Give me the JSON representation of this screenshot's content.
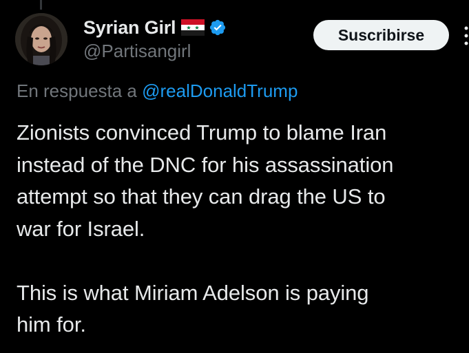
{
  "user": {
    "display_name": "Syrian Girl",
    "handle": "@Partisangirl",
    "verified": true,
    "flag": "syria-flag"
  },
  "header": {
    "subscribe_label": "Suscribirse",
    "more_icon": "more-vertical-icon"
  },
  "reply": {
    "prefix": "En respuesta a",
    "mention": "@realDonaldTrump"
  },
  "tweet": {
    "text": "Zionists convinced Trump to blame Iran\ninstead of the DNC for his assassination\nattempt so that they can drag the US to\nwar for Israel.\n\nThis is what Miriam Adelson is paying\nhim for."
  },
  "colors": {
    "background": "#000000",
    "text_primary": "#e7e9ea",
    "text_secondary": "#71767b",
    "link": "#1d9bf0",
    "verified_badge": "#1d9bf0",
    "button_bg": "#eff3f4"
  }
}
